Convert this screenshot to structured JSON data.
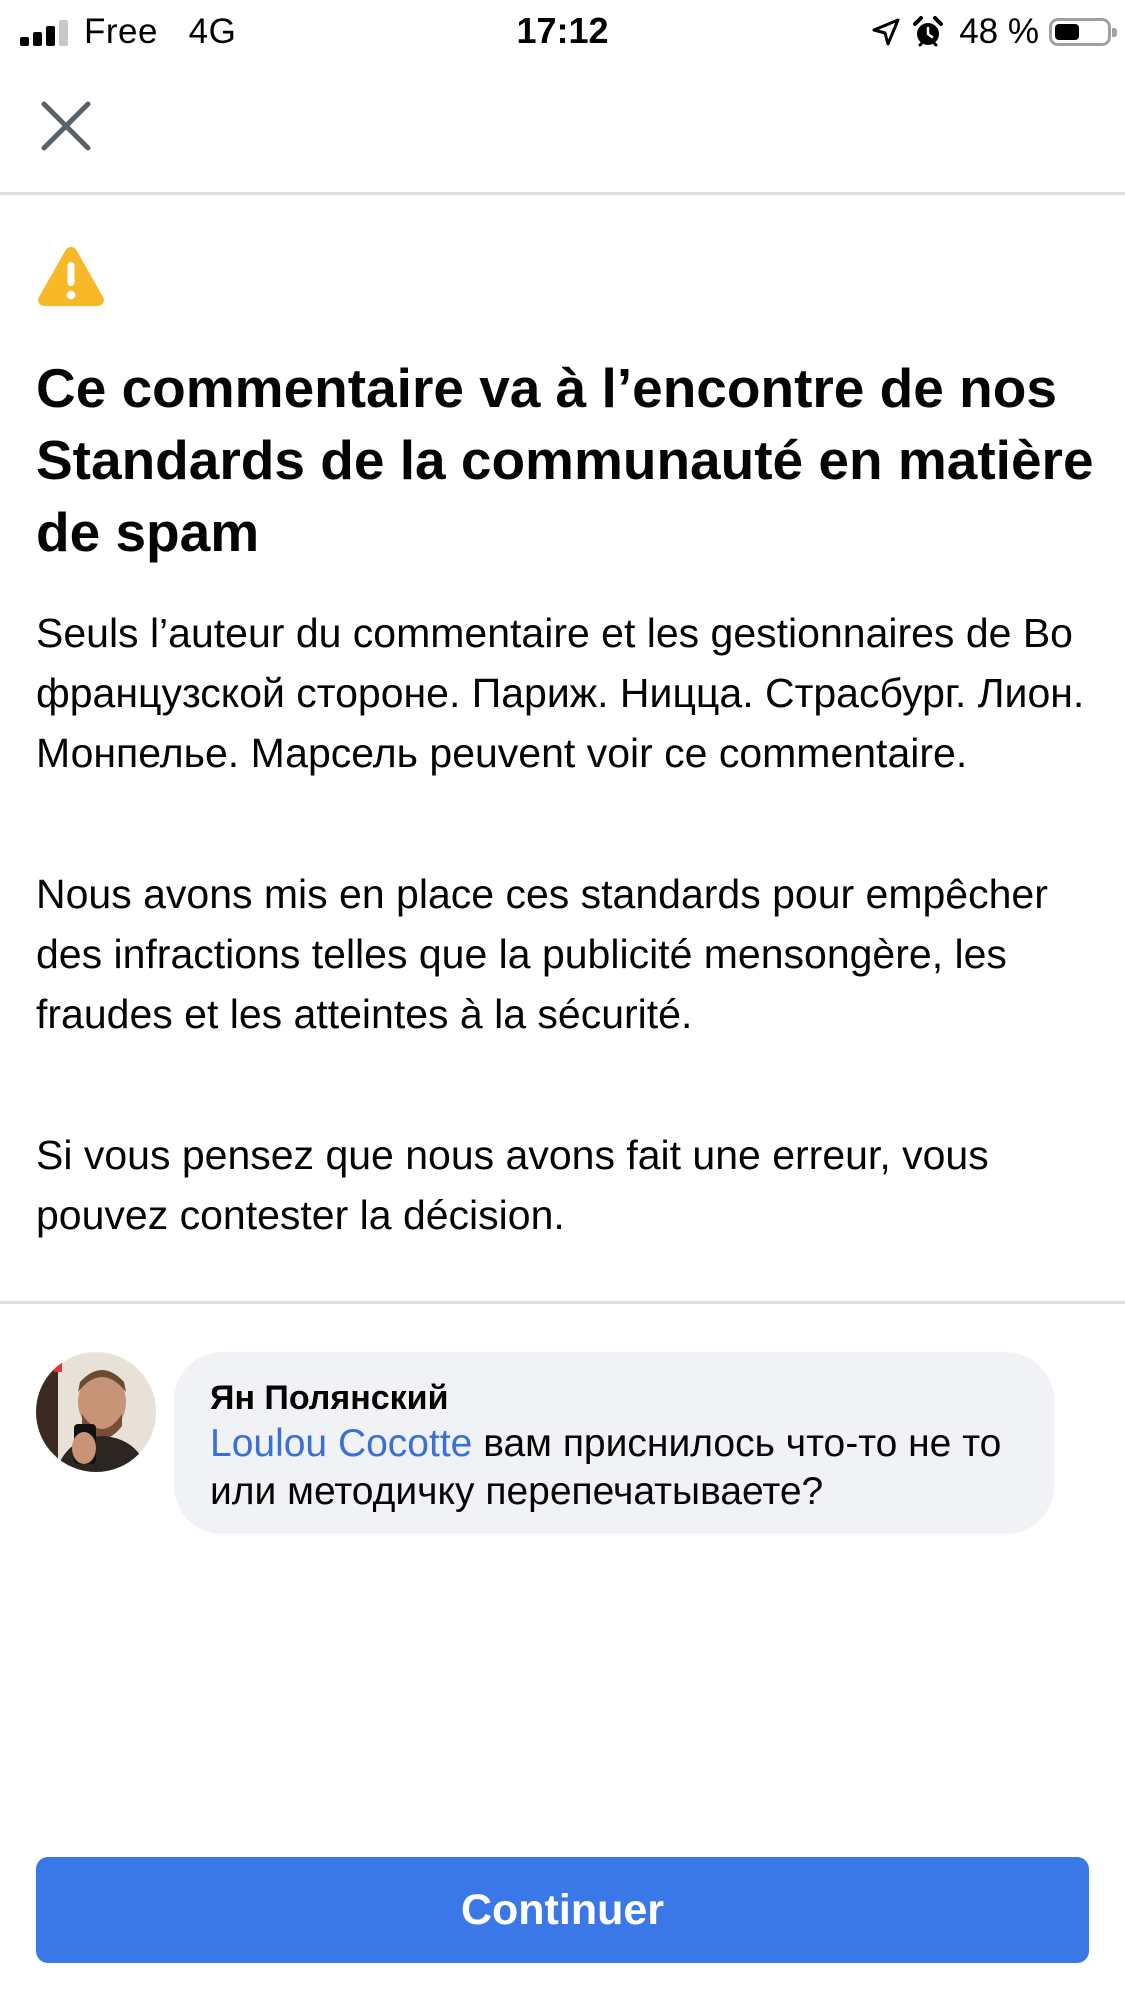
{
  "status_bar": {
    "carrier": "Free",
    "network": "4G",
    "time": "17:12",
    "battery_percent_label": "48 %",
    "battery_level": 0.48,
    "icons": [
      "signal-icon",
      "location-arrow-icon",
      "alarm-clock-icon",
      "battery-icon"
    ]
  },
  "header": {
    "close_icon": "close-icon"
  },
  "notice": {
    "icon": "warning-icon",
    "icon_color": "#f7b928",
    "title": "Ce commentaire va à l’encontre de nos Standards de la communauté en matière de spam",
    "paragraphs": [
      "Seuls l’auteur du commentaire et les gestionnaires de Во французской стороне. Париж. Ницца. Страсбург. Лион. Монпелье. Марсель peuvent voir ce commentaire.",
      "Nous avons mis en place ces standards pour empêcher des infractions telles que la publicité mensongère, les fraudes et les atteintes à la sécurité.",
      "Si vous pensez que nous avons fait une erreur, vous pouvez contester la décision."
    ]
  },
  "comment": {
    "author": "Ян Полянский",
    "mention": "Loulou Cocotte",
    "text": " вам приснилось что-то не то или методичку перепечатываете?",
    "mention_color": "#3a6fd8"
  },
  "actions": {
    "continue_label": "Continuer",
    "button_color": "#3b78e7"
  }
}
